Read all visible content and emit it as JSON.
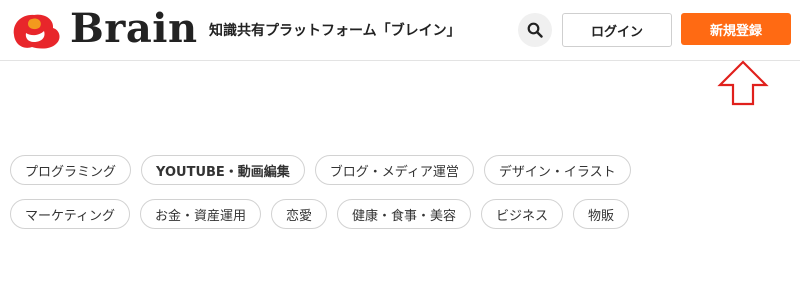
{
  "header": {
    "logo_text": "Brain",
    "tagline": "知識共有プラットフォーム「ブレイン」",
    "login_label": "ログイン",
    "register_label": "新規登録"
  },
  "categories": [
    "プログラミング",
    "YOUTUBE・動画編集",
    "ブログ・メディア運営",
    "デザイン・イラスト",
    "マーケティング",
    "お金・資産運用",
    "恋愛",
    "健康・食事・美容",
    "ビジネス",
    "物販"
  ],
  "colors": {
    "accent": "#ff6a13",
    "logo_red": "#e8262b",
    "logo_orange": "#f39a1e",
    "annotation_arrow": "#e0201c"
  },
  "icons": {
    "search": "search-icon",
    "annotation": "up-arrow-icon"
  }
}
